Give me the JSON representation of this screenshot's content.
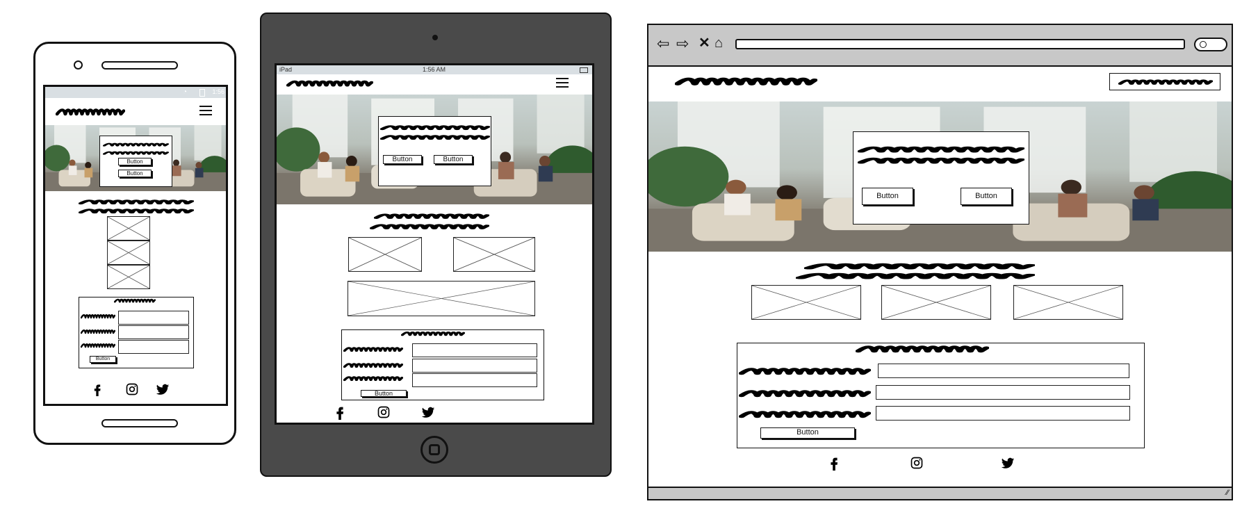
{
  "mockup": {
    "button_label": "Button",
    "tablet_status": {
      "left": "iPad",
      "time": "1:56 AM"
    },
    "phone_status": {
      "time": "1:56"
    },
    "social_icons": [
      "facebook-icon",
      "instagram-icon",
      "twitter-icon"
    ],
    "colors": {
      "ink": "#111111",
      "tablet_frame": "#4a4a4a",
      "browser_chrome": "#c8c8c8",
      "status_bar": "#d9dfe3"
    }
  }
}
